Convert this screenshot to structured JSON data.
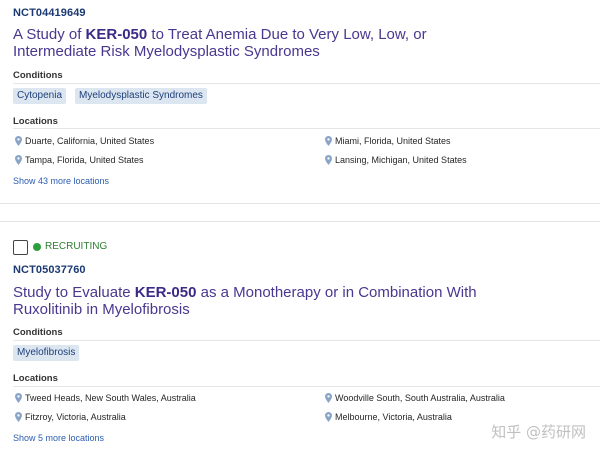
{
  "trials": [
    {
      "nct": "NCT04419649",
      "title_pre": "A Study of ",
      "title_bold": "KER-050",
      "title_post": " to Treat Anemia Due to Very Low, Low, or Intermediate Risk Myelodysplastic Syndromes",
      "conditions_label": "Conditions",
      "conditions": [
        "Cytopenia",
        "Myelodysplastic Syndromes"
      ],
      "locations_label": "Locations",
      "locations": [
        "Duarte, California, United States",
        "Miami, Florida, United States",
        "Tampa, Florida, United States",
        "Lansing, Michigan, United States"
      ],
      "more_link": "Show 43 more locations"
    },
    {
      "status": "RECRUITING",
      "nct": "NCT05037760",
      "title_pre": "Study to Evaluate ",
      "title_bold": "KER-050",
      "title_post": " as a Monotherapy or in Combination With Ruxolitinib in Myelofibrosis",
      "conditions_label": "Conditions",
      "conditions": [
        "Myelofibrosis"
      ],
      "locations_label": "Locations",
      "locations": [
        "Tweed Heads, New South Wales, Australia",
        "Woodville South, South Australia, Australia",
        "Fitzroy, Victoria, Australia",
        "Melbourne, Victoria, Australia"
      ],
      "more_link": "Show 5 more locations"
    }
  ],
  "icons": {
    "location": "map-pin-icon",
    "status": "green-dot-icon"
  },
  "colors": {
    "title": "#4a3790",
    "link": "#2a5db0",
    "chip_bg": "#dce6f1",
    "recruiting": "#2e7d32"
  },
  "watermark": "知乎 @药研网"
}
